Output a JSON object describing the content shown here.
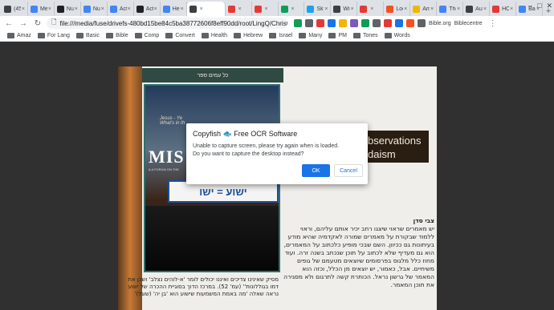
{
  "browser": {
    "tabs": [
      {
        "title": "(45",
        "color": "#3c4043"
      },
      {
        "title": "Me",
        "color": "#4285f4"
      },
      {
        "title": "Nu",
        "color": "#202124"
      },
      {
        "title": "Nu",
        "color": "#4285f4"
      },
      {
        "title": "Act",
        "color": "#4285f4"
      },
      {
        "title": "Act",
        "color": "#202124"
      },
      {
        "title": "Heb",
        "color": "#4285f4"
      },
      {
        "title": "",
        "color": "#3c4043",
        "active": true
      },
      {
        "title": "",
        "color": "#e53935"
      },
      {
        "title": "",
        "color": "#e53935"
      },
      {
        "title": "",
        "color": "#0f9d58"
      },
      {
        "title": "Sky",
        "color": "#1da1f2"
      },
      {
        "title": "Wi",
        "color": "#3c4043"
      },
      {
        "title": "",
        "color": "#e53935"
      },
      {
        "title": "Loc",
        "color": "#f4511e"
      },
      {
        "title": "Am",
        "color": "#f4b400"
      },
      {
        "title": "The",
        "color": "#4285f4"
      },
      {
        "title": "Aut",
        "color": "#3c4043"
      },
      {
        "title": "HO",
        "color": "#e53935"
      },
      {
        "title": "Bac",
        "color": "#4285f4"
      }
    ],
    "address": "file:///media/fuse/drivefs-480bd15be84c5ba38772606f8eff90dd/root/LingQ/Christ...",
    "extensions": [
      {
        "color": "#0f9d58"
      },
      {
        "color": "#5f6368"
      },
      {
        "color": "#e53935"
      },
      {
        "color": "#1a73e8"
      },
      {
        "color": "#f4b400"
      },
      {
        "color": "#7e57c2"
      },
      {
        "color": "#0f9d58"
      },
      {
        "color": "#5f6368"
      },
      {
        "color": "#e53935"
      },
      {
        "color": "#1a73e8"
      },
      {
        "color": "#f4511e"
      },
      {
        "color": "#5f6368"
      }
    ],
    "ext_bible": "Bible.org",
    "ext_biblecentre": "Biblecentre",
    "bookmarks": [
      "Amaz",
      "For Lang",
      "Basic",
      "Bible",
      "Comp",
      "Convert",
      "Health",
      "Hebrew",
      "Israel",
      "Many",
      "PM",
      "Tones",
      "Words"
    ]
  },
  "document": {
    "spine_text": "כל עמים ספר",
    "sign_text": "Jesus - Ye\nWhat's in th",
    "mag_title": "MIS",
    "mag_subtitle": "& A FORUM ON THE",
    "bus_sign": "ישוע = ישו",
    "observations": "bservations",
    "daism": "daism",
    "author": "צבי סדן",
    "body_text": "יש מאמרים שראוי שיצגו רחב יכיר אותם עליהם, וראוי ללמוד שבקורת על מאמרים שמורה לאקדמיה שהיא מודע בעיתונות גם ככיוון. השם שבכי מופיע כלכתוב על המאמרים, הוא גם מעדיף שלא לכתוב על תוכן שנכתב בשנה זרה. ועוד מחוז כלל מלגוס בפרסומים שיוצאים מטעמם של גופים משיחיים. אבל, כאמור, יש יוצאים מן הכלל, וכזה הוא המאמר של גרשון נראל. הכותרת קשה לתרגום ולא מסגירה את תוכן המאמר.",
    "col2_text": "מסיק שאינינו צדיכים ואיננו יכולים לומר 'א-לוהים נצלב' ושכן את דמו בגוללונות'' (עמ' 52). במרכז הדוך בסוגיית ההכרה של ישוע נראה שאלה 'מה באמת המשמעות שישוע הוא 'בן יה' (שוגל)'"
  },
  "dialog": {
    "title": "Copyfish",
    "fish": "🐟",
    "title_rest": "Free OCR Software",
    "line1": "Unable to capture screen, please try again when is loaded.",
    "line2": "Do you want to capture the desktop instead?",
    "ok": "OK",
    "cancel": "Cancel"
  }
}
